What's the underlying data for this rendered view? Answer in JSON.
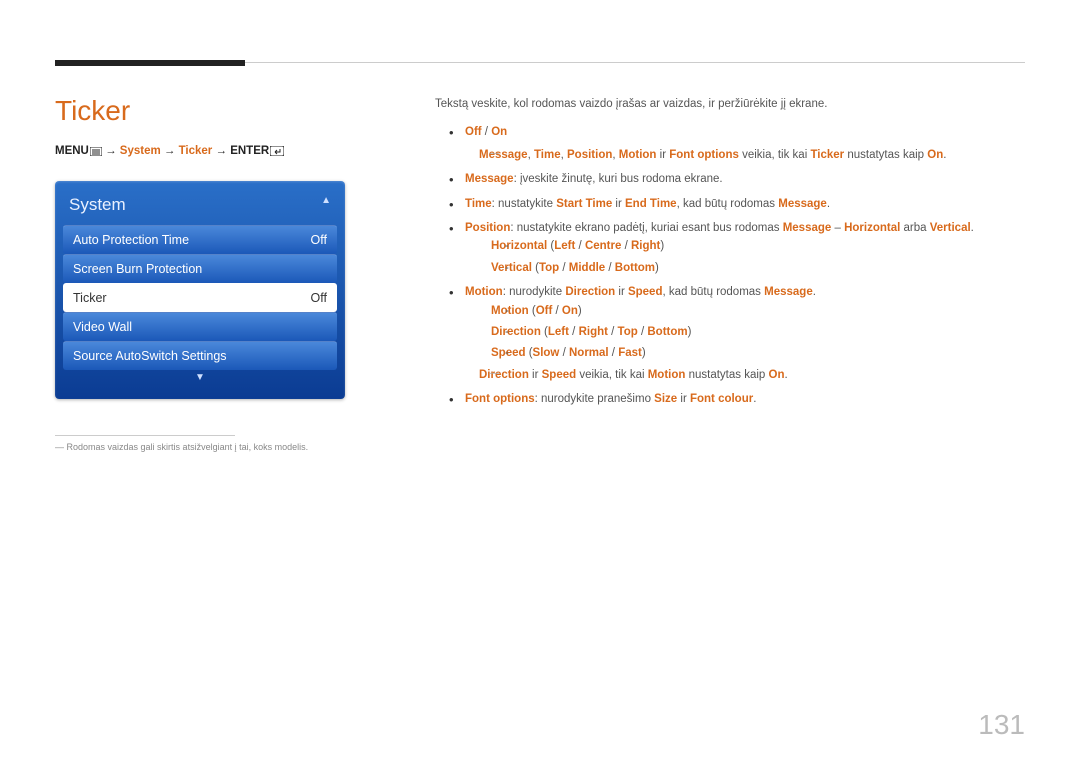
{
  "pageNumber": "131",
  "heading": "Ticker",
  "breadcrumb": {
    "menu": "MENU",
    "system": "System",
    "ticker": "Ticker",
    "enter": "ENTER",
    "arrow": "→"
  },
  "osd": {
    "title": "System",
    "rows": [
      {
        "label": "Auto Protection Time",
        "value": "Off",
        "selected": false
      },
      {
        "label": "Screen Burn Protection",
        "value": "",
        "selected": false
      },
      {
        "label": "Ticker",
        "value": "Off",
        "selected": true
      },
      {
        "label": "Video Wall",
        "value": "",
        "selected": false
      },
      {
        "label": "Source AutoSwitch Settings",
        "value": "",
        "selected": false
      }
    ]
  },
  "footnote": "Rodomas vaizdas gali skirtis atsižvelgiant į tai, koks modelis.",
  "intro": "Tekstą veskite, kol rodomas vaizdo įrašas ar vaizdas, ir peržiūrėkite jį ekrane.",
  "b1": {
    "off": "Off",
    "sep": " / ",
    "on": "On"
  },
  "d1": {
    "p1": "Message",
    "p2": "Time",
    "p3": "Position",
    "p4": "Motion",
    "mid": " ir ",
    "p5": "Font options",
    "txt": " veikia, tik kai ",
    "p6": "Ticker",
    "tail": " nustatytas kaip ",
    "p7": "On"
  },
  "b2": {
    "h": "Message",
    "t": ": įveskite žinutę, kuri bus rodoma ekrane."
  },
  "b3": {
    "h": "Time",
    "t1": ": nustatykite ",
    "s1": "Start Time",
    "mid": " ir ",
    "s2": "End Time",
    "t2": ", kad būtų rodomas ",
    "s3": "Message",
    "dot": "."
  },
  "b4": {
    "h": "Position",
    "t1": ": nustatykite ekrano padėtį, kuriai esant bus rodomas ",
    "s1": "Message",
    "dash": " – ",
    "s2": "Horizontal",
    "mid": " arba ",
    "s3": "Vertical",
    "dot": "."
  },
  "s41": {
    "h": "Horizontal",
    "o1": "Left",
    "o2": "Centre",
    "o3": "Right"
  },
  "s42": {
    "h": "Vertical",
    "o1": "Top",
    "o2": "Middle",
    "o3": "Bottom"
  },
  "b5": {
    "h": "Motion",
    "t1": ": nurodykite ",
    "s1": "Direction",
    "mid": " ir ",
    "s2": "Speed",
    "t2": ", kad būtų rodomas ",
    "s3": "Message",
    "dot": "."
  },
  "s51": {
    "h": "Motion",
    "o1": "Off",
    "o2": "On"
  },
  "s52": {
    "h": "Direction",
    "o1": "Left",
    "o2": "Right",
    "o3": "Top",
    "o4": "Bottom"
  },
  "s53": {
    "h": "Speed",
    "o1": "Slow",
    "o2": "Normal",
    "o3": "Fast"
  },
  "d5": {
    "p1": "Direction",
    "mid": " ir ",
    "p2": "Speed",
    "txt": " veikia, tik kai ",
    "p3": "Motion",
    "tail": " nustatytas kaip ",
    "p4": "On",
    "dot": "."
  },
  "b6": {
    "h": "Font options",
    "t1": ": nurodykite pranešimo ",
    "s1": "Size",
    "mid": " ir ",
    "s2": "Font colour",
    "dot": "."
  },
  "paren": {
    "open": " (",
    "close": ")",
    "sep": " / "
  }
}
